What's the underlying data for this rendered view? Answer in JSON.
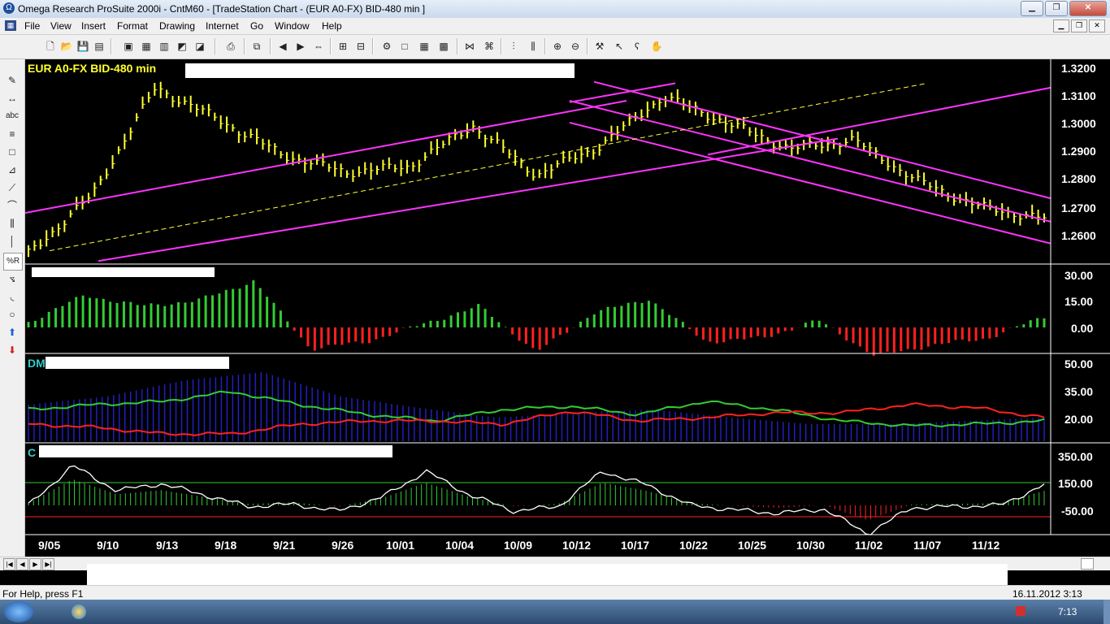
{
  "window": {
    "title": "Omega Research ProSuite 2000i - CntM60 - [TradeStation Chart - (EUR A0-FX)  BID-480 min ]",
    "min_glyph": "▁",
    "max_glyph": "❐",
    "close_glyph": "✕"
  },
  "menu": {
    "items": [
      "File",
      "View",
      "Insert",
      "Format",
      "Drawing",
      "Internet",
      "Go",
      "Window",
      "Help"
    ]
  },
  "chart": {
    "price_title": "EUR A0-FX BID-480 min",
    "dmi_prefix": "DM",
    "cci_prefix": "C",
    "price_axis": [
      "1.3200",
      "1.3100",
      "1.3000",
      "1.2900",
      "1.2800",
      "1.2700",
      "1.2600"
    ],
    "osc_axis": [
      "30.00",
      "15.00",
      "0.00"
    ],
    "dmi_axis": [
      "50.00",
      "35.00",
      "20.00"
    ],
    "cci_axis": [
      "350.00",
      "150.00",
      "-50.00"
    ],
    "dates": [
      "9/05",
      "9/10",
      "9/13",
      "9/18",
      "9/21",
      "9/26",
      "10/01",
      "10/04",
      "10/09",
      "10/12",
      "10/17",
      "10/22",
      "10/25",
      "10/30",
      "11/02",
      "11/07",
      "11/12"
    ],
    "colors": {
      "bars": "#ffff33",
      "channel": "#ff33ff",
      "osc_up": "#33cc33",
      "osc_down": "#ff2020",
      "dmi_plus": "#33cc33",
      "dmi_minus": "#ff2020",
      "adx": "#2020c0",
      "cci": "#ffffff"
    }
  },
  "chart_data": {
    "type": "line",
    "title": "EUR A0-FX BID-480 min",
    "x": [
      "9/05",
      "9/10",
      "9/13",
      "9/18",
      "9/21",
      "9/26",
      "10/01",
      "10/04",
      "10/09",
      "10/12",
      "10/17",
      "10/22",
      "10/25",
      "10/30",
      "11/02",
      "11/07",
      "11/12"
    ],
    "series": [
      {
        "values": [
          1.258,
          1.278,
          1.315,
          1.304,
          1.292,
          1.286,
          1.288,
          1.302,
          1.285,
          1.295,
          1.312,
          1.303,
          1.294,
          1.297,
          1.283,
          1.274,
          1.27
        ]
      }
    ],
    "ylim": [
      1.255,
      1.3225
    ]
  },
  "statusbar": {
    "help": "For Help, press F1",
    "datetime": "16.11.2012 3:13 (GMT)"
  },
  "taskbar": {
    "clock": "7:13"
  }
}
